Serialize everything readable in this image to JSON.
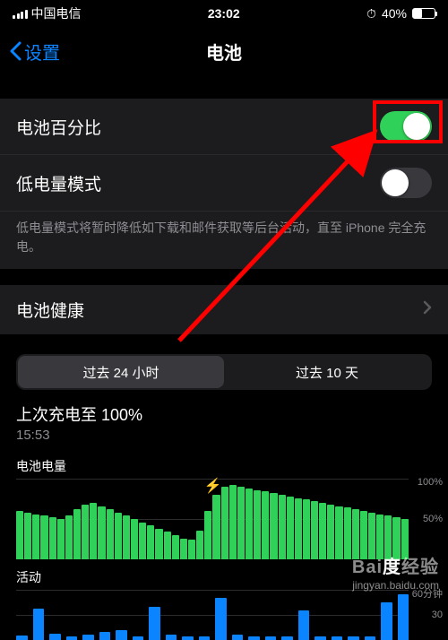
{
  "status": {
    "carrier": "中国电信",
    "time": "23:02",
    "alarm_icon": "⏰",
    "battery_pct": "40%"
  },
  "nav": {
    "back_label": "设置",
    "title": "电池"
  },
  "rows": {
    "battery_pct_label": "电池百分比",
    "low_power_label": "低电量模式",
    "low_power_footer": "低电量模式将暂时降低如下载和邮件获取等后台活动，直至 iPhone 完全充电。",
    "battery_health_label": "电池健康"
  },
  "segmented": {
    "past24h": "过去 24 小时",
    "past10d": "过去 10 天"
  },
  "charge": {
    "title": "上次充电至 100%",
    "time": "15:53"
  },
  "chartHeaders": {
    "level": "电池电量",
    "activity": "活动"
  },
  "axis": {
    "pct100": "100%",
    "pct50": "50%",
    "min60": "60分钟",
    "min30": "30"
  },
  "watermark": {
    "brand": "Baidu 经验",
    "url": "jingyan.baidu.com"
  },
  "chart_data": {
    "type": "bar",
    "level_pct": [
      60,
      58,
      56,
      54,
      52,
      50,
      55,
      62,
      68,
      70,
      66,
      62,
      58,
      54,
      50,
      46,
      42,
      38,
      34,
      30,
      26,
      24,
      36,
      60,
      80,
      90,
      92,
      90,
      88,
      86,
      84,
      82,
      80,
      78,
      76,
      74,
      72,
      70,
      68,
      66,
      64,
      62,
      60,
      58,
      56,
      54,
      52,
      50
    ],
    "charging_index": 23,
    "activity_min": [
      5,
      38,
      8,
      4,
      6,
      10,
      12,
      4,
      40,
      6,
      4,
      4,
      50,
      6,
      4,
      4,
      4,
      35,
      4,
      4,
      4,
      4,
      45,
      55
    ],
    "ylim_level": [
      0,
      100
    ],
    "ylim_activity": [
      0,
      60
    ],
    "xlabel": "",
    "ylabel": ""
  }
}
